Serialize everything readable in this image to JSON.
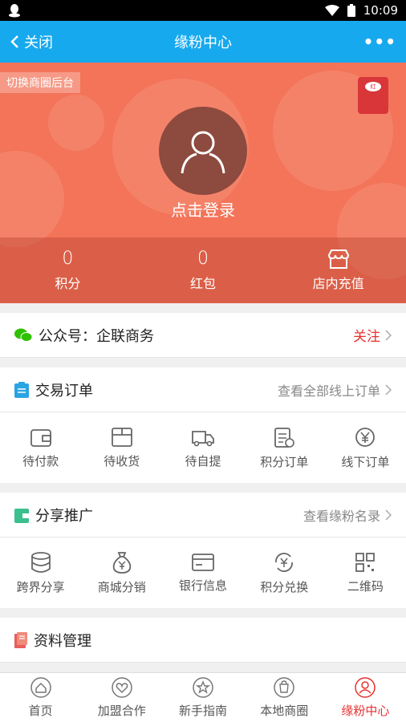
{
  "status_bar": {
    "time": "10:09"
  },
  "nav": {
    "back_label": "关闭",
    "title": "缘粉中心",
    "more": "•••"
  },
  "hero": {
    "switch_label": "切换商圈后台",
    "login_label": "点击登录",
    "stats": [
      {
        "value": "0",
        "label": "积分"
      },
      {
        "value": "0",
        "label": "红包"
      },
      {
        "value": "",
        "label": "店内充值"
      }
    ]
  },
  "official": {
    "label": "公众号：企联商务",
    "action": "关注"
  },
  "orders": {
    "title": "交易订单",
    "link": "查看全部线上订单",
    "items": [
      "待付款",
      "待收货",
      "待自提",
      "积分订单",
      "线下订单"
    ]
  },
  "share": {
    "title": "分享推广",
    "link": "查看缘粉名录",
    "items": [
      "跨界分享",
      "商城分销",
      "银行信息",
      "积分兑换",
      "二维码"
    ]
  },
  "profile": {
    "title": "资料管理"
  },
  "tabbar": {
    "items": [
      "首页",
      "加盟合作",
      "新手指南",
      "本地商圈",
      "缘粉中心"
    ],
    "active_color": "#e8312f"
  },
  "colors": {
    "nav": "#17a9ee",
    "hero": "#f37459",
    "accent": "#e8312f"
  }
}
